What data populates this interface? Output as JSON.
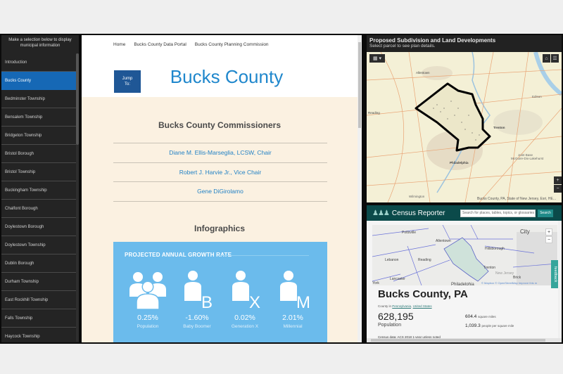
{
  "sidebar": {
    "header": "Make a selection below to display municipal information",
    "items": [
      {
        "label": "Introduction",
        "active": false
      },
      {
        "label": "Bucks County",
        "active": true
      },
      {
        "label": "Bedminster Township",
        "active": false
      },
      {
        "label": "Bensalem Township",
        "active": false
      },
      {
        "label": "Bridgeton Township",
        "active": false
      },
      {
        "label": "Bristol Borough",
        "active": false
      },
      {
        "label": "Bristol Township",
        "active": false
      },
      {
        "label": "Buckingham Township",
        "active": false
      },
      {
        "label": "Chalfont Borough",
        "active": false
      },
      {
        "label": "Doylestown Borough",
        "active": false
      },
      {
        "label": "Doylestown Township",
        "active": false
      },
      {
        "label": "Dublin Borough",
        "active": false
      },
      {
        "label": "Durham Township",
        "active": false
      },
      {
        "label": "East Rockhill Township",
        "active": false
      },
      {
        "label": "Falls Township",
        "active": false
      },
      {
        "label": "Haycock Township",
        "active": false
      }
    ]
  },
  "center": {
    "nav": [
      "Home",
      "Bucks County Data Portal",
      "Bucks County Planning Commission"
    ],
    "jump_line1": "Jump",
    "jump_line2": "To:",
    "title": "Bucks County",
    "commissioners_title": "Bucks County Commissioners",
    "commissioners": [
      "Diane M. Ellis-Marseglia, LCSW, Chair",
      "Robert J. Harvie Jr., Vice Chair",
      "Gene DiGirolamo"
    ],
    "infographics_title": "Infographics",
    "growth": {
      "heading": "PROJECTED ANNUAL GROWTH RATE",
      "stats": [
        {
          "icon": "population",
          "value": "0.25%",
          "label": "Population"
        },
        {
          "icon": "B",
          "value": "-1.60%",
          "label": "Baby Boomer"
        },
        {
          "icon": "X",
          "value": "0.02%",
          "label": "Generation X"
        },
        {
          "icon": "M",
          "value": "2.01%",
          "label": "Millennial"
        }
      ]
    }
  },
  "map": {
    "title": "Proposed Subdivision and Land Developments",
    "subtitle": "Select parcel to see plan details.",
    "labels": [
      "Allentown",
      "Reading",
      "Trenton",
      "Philadelphia",
      "Joint Base McGuire-Dix-Lakehurst",
      "Wilmington",
      "Edison"
    ],
    "attribution": "Bucks County, PA, State of New Jersey, Esri, HE..."
  },
  "census": {
    "brand": "Census Reporter",
    "search_placeholder": "Search for places, tables, topics, or glossaries",
    "search_button": "Search",
    "map_labels": [
      "Pottsville",
      "Allentown",
      "City",
      "Hillsborough",
      "Lebanon",
      "Reading",
      "Trenton",
      "New Jersey",
      "Brick",
      "Lancaster",
      "York",
      "Philadelphia"
    ],
    "map_attribution": "© Mapbox © OpenStreetMap Improve this m",
    "feedback": "feedback",
    "place_name": "Bucks County, PA",
    "place_sub_prefix": "County in ",
    "place_state": "Pennsylvania",
    "place_country": "United States",
    "population": "628,195",
    "population_label": "Population",
    "area_value": "604.4",
    "area_unit": "square miles",
    "density_value": "1,039.3",
    "density_unit": "people per square mile",
    "note_label": "Census data:",
    "note_text": "ACS 2018 1-year unless noted"
  }
}
